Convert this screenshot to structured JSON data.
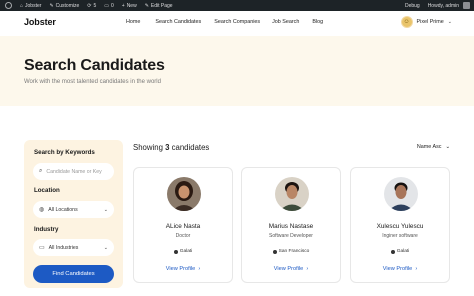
{
  "adminbar": {
    "items": [
      {
        "label": "Jobster",
        "icon": "home-icon"
      },
      {
        "label": "Customize",
        "icon": "brush-icon"
      },
      {
        "label": "5",
        "icon": "refresh-icon"
      },
      {
        "label": "0",
        "icon": "comment-icon"
      },
      {
        "label": "New",
        "icon": "plus-icon"
      },
      {
        "label": "Edit Page",
        "icon": "pencil-icon"
      }
    ],
    "debug": "Debug",
    "howdy": "Howdy, admin"
  },
  "header": {
    "logo": "Jobster",
    "nav": [
      "Home",
      "Search Candidates",
      "Search Companies",
      "Job Search",
      "Blog"
    ],
    "user_name": "Pixel Prime"
  },
  "hero": {
    "title": "Search Candidates",
    "subtitle": "Work with the most talented candidates in the world"
  },
  "sidebar": {
    "keywords_label": "Search by Keywords",
    "keywords_placeholder": "Candidate Name or Key",
    "location_label": "Location",
    "location_value": "All Locations",
    "industry_label": "Industry",
    "industry_value": "All Industries",
    "button": "Find Candidates"
  },
  "results": {
    "showing_prefix": "Showing",
    "count": "3",
    "showing_suffix": "candidates",
    "sort": "Name Asc"
  },
  "candidates": [
    {
      "name": "ALice Nasta",
      "role": "Doctor",
      "location": "Galati",
      "link": "View Profile"
    },
    {
      "name": "Marius Nastase",
      "role": "Software Developer",
      "location": "San Francisco",
      "link": "View Profile"
    },
    {
      "name": "Xulescu Yulescu",
      "role": "Inginer software",
      "location": "Galati",
      "link": "View Profile"
    }
  ],
  "colors": {
    "accent": "#1d5ac4",
    "hero_bg": "#fdf8ec",
    "sidebar_bg": "#fdf3e1",
    "adminbar": "#1d2327"
  }
}
